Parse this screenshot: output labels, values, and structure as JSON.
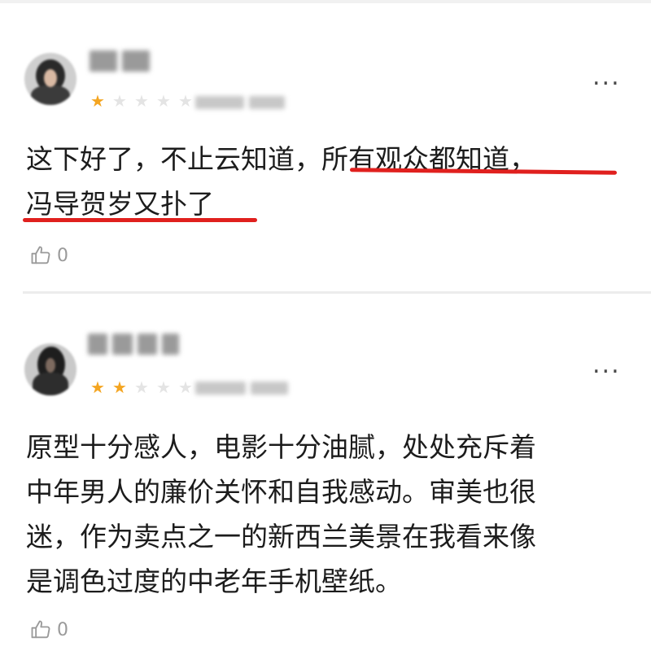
{
  "comments": [
    {
      "rating": 1,
      "rating_max": 5,
      "text_lines": [
        "这下好了，不止云知道，所有观众都知道，",
        "冯导贺岁又扑了"
      ],
      "likes": "0",
      "more_label": "..."
    },
    {
      "rating": 2,
      "rating_max": 5,
      "text_lines": [
        "原型十分感人，电影十分油腻，处处充斥着",
        "中年男人的廉价关怀和自我感动。审美也很",
        "迷，作为卖点之一的新西兰美景在我看来像",
        "是调色过度的中老年手机壁纸。"
      ],
      "likes": "0",
      "more_label": "..."
    }
  ],
  "colors": {
    "star_on": "#f4a521",
    "star_off": "#e4e4e4",
    "underline": "#e0201e"
  }
}
